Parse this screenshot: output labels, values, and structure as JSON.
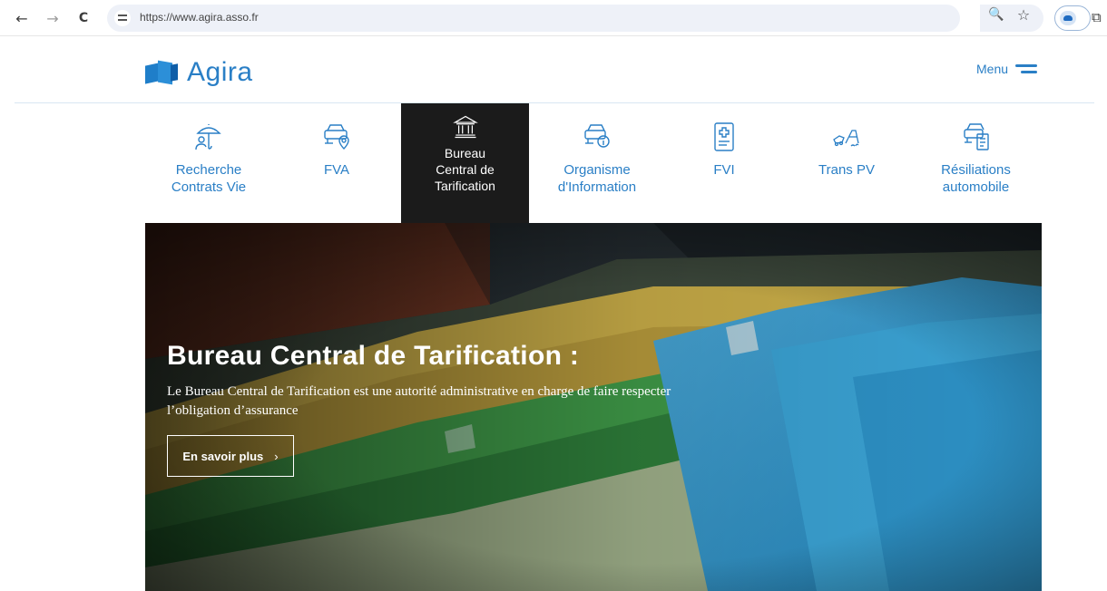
{
  "browser": {
    "back_glyph": "←",
    "forward_glyph": "→",
    "reload_glyph": "C",
    "url": "https://www.agira.asso.fr",
    "zoom_glyph": "🔍",
    "star_glyph": "☆",
    "puzzle_glyph": "⧉"
  },
  "site": {
    "logo_text": "Agira",
    "menu_label": "Menu",
    "brand_color": "#2a7fc6"
  },
  "services": [
    {
      "label": "Recherche\nContrats Vie",
      "icon": "umbrella-person-icon"
    },
    {
      "label": "FVA",
      "icon": "car-location-icon"
    },
    {
      "label": "Bureau\nCentral de\nTarification",
      "icon": "institution-icon"
    },
    {
      "label": "Organisme\nd'Information",
      "icon": "car-info-icon"
    },
    {
      "label": "FVI",
      "icon": "medical-document-icon"
    },
    {
      "label": "Trans PV",
      "icon": "car-accident-icon"
    },
    {
      "label": "Résiliations\nautomobile",
      "icon": "car-document-icon"
    }
  ],
  "active_service_index": 2,
  "hero": {
    "title": "Bureau Central de Tarification :",
    "description": "Le Bureau Central de Tarification est une autorité administrative en charge de faire respecter l’obligation d’assurance",
    "cta_label": "En savoir plus",
    "cta_chevron": "›"
  }
}
